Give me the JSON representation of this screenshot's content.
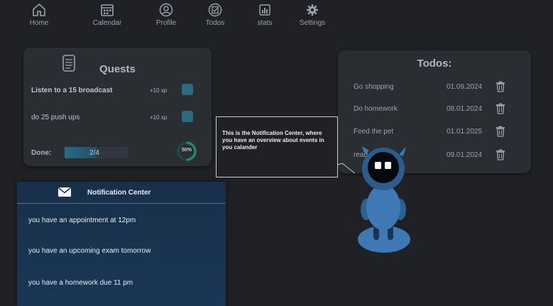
{
  "nav": {
    "items": [
      {
        "label": "Home",
        "icon": "home-icon"
      },
      {
        "label": "Calendar",
        "icon": "calendar-icon"
      },
      {
        "label": "Profile",
        "icon": "profile-icon"
      },
      {
        "label": "Todos",
        "icon": "todos-icon"
      },
      {
        "label": "stats",
        "icon": "stats-icon"
      },
      {
        "label": "Settings",
        "icon": "gear-icon"
      }
    ]
  },
  "quests": {
    "title": "Quests",
    "items": [
      {
        "label": "Listen to a 15 broadcast",
        "xp": "+10 xp"
      },
      {
        "label": "do 25 push ups",
        "xp": "+10 xp"
      }
    ],
    "done_label": "Done:",
    "progress_text": "2/4",
    "progress_fraction": 0.5,
    "ring_text": "50%"
  },
  "todos": {
    "title": "Todos:",
    "items": [
      {
        "label": "Go shopping",
        "date": "01.09.2024"
      },
      {
        "label": "Do homework",
        "date": "08.01.2024"
      },
      {
        "label": "Feed the pet",
        "date": "01.01.2025"
      },
      {
        "label": "read",
        "date": "09.01.2024"
      }
    ]
  },
  "notification_center": {
    "title": "Notification Center",
    "items": [
      "you have an appointment at 12pm",
      "you have an upcoming exam tomorrow",
      "you have a homework due 11 pm"
    ]
  },
  "tooltip": {
    "text": "This is the Notification Center, where you have an overview about events in you calander"
  },
  "colors": {
    "background": "#1f2124",
    "panel": "#2a2e33",
    "accent": "#2b6a80",
    "notification_bg": "#18304a",
    "robot": "#3e79b4",
    "ring": "#1f8a6b"
  }
}
